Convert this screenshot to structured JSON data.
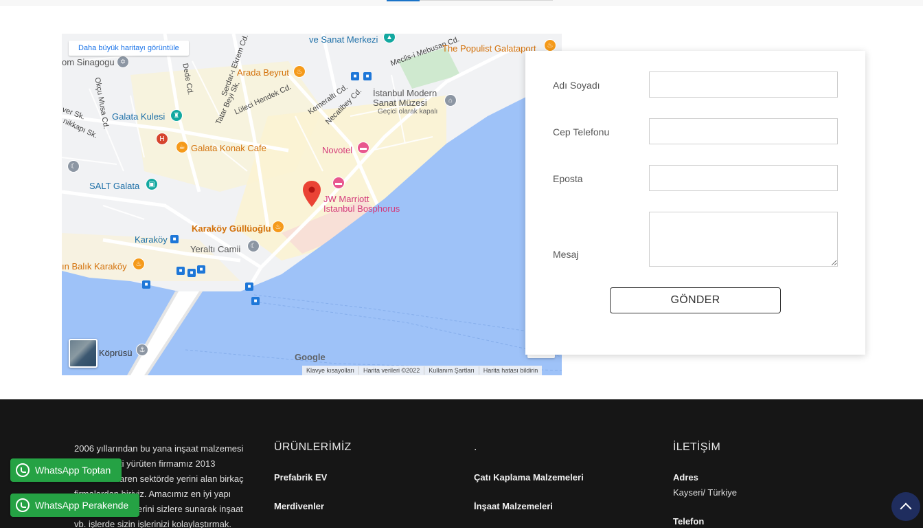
{
  "map": {
    "larger_map_link": "Daha büyük haritayı görüntüle",
    "labels": {
      "sanat_merkezi": "ve Sanat Merkezi",
      "populist": "The Populist Galataport",
      "sinagogu": "om Sinagogu",
      "arada_beyrut": "Arada Beyrut",
      "mebusan": "Meclis-i Mebusan Cd.",
      "kemeralti": "Kemeraltı Cd.",
      "necatibey": "Necatibey Cd.",
      "lulecihendek": "Lüleci Hendek Cd.",
      "serdar": "Serdar-ı Ekrem Cd.",
      "tatarbeyi": "Tatar Beyi Sk.",
      "dede": "Dede Cd.",
      "okcu": "Okçu Musa Cd.",
      "ver_sk": "ver Sk.",
      "kikapi": "nikkapı Sk.",
      "istanbul_modern_1": "İstanbul Modern",
      "istanbul_modern_2": "Sanat Müzesi",
      "istanbul_modern_3": "Geçici olarak kapalı",
      "galata_kulesi": "Galata Kulesi",
      "galata_konak": "Galata Konak Cafe",
      "novotel": "Novotel",
      "salt_galata": "SALT Galata",
      "jw_1": "JW Marriott",
      "jw_2": "Istanbul Bosphorus",
      "karakoy_gulluoglu": "Karaköy Güllüoğlu",
      "karakoy": "Karaköy",
      "yeralti": "Yeraltı Camii",
      "balik": "ın Balık Karaköy",
      "koprusu": "Köprüsü"
    },
    "google": "Google",
    "attribution": [
      "Klavye kısayolları",
      "Harita verileri ©2022",
      "Kullanım Şartları",
      "Harita hatası bildirin"
    ]
  },
  "form": {
    "name_label": "Adı Soyadı",
    "phone_label": "Cep Telefonu",
    "email_label": "Eposta",
    "message_label": "Mesaj",
    "submit_label": "GÖNDER"
  },
  "footer": {
    "about_lines": [
      "2006 yıllarından bu yana inşaat malzemesi",
      "ti  yürüten firmamız 2013",
      "aren sektörde yerini alan birkaç",
      "firmalardan biriyiz. Amacımız en iyi yapı",
      "erini sizlere sunarak inşaat",
      "vb. işlerde sizin işlerinizi kolaylaştırmak."
    ],
    "col2_head": "ÜRÜNLERİMİZ",
    "col2_links": [
      "Prefabrik EV",
      "Merdivenler"
    ],
    "col3_head": ".",
    "col3_links": [
      "Çatı Kaplama Malzemeleri",
      "İnşaat Malzemeleri"
    ],
    "col4_head": "İLETİŞİM",
    "address_label": "Adres",
    "address_value": "Kayseri/ Türkiye",
    "phone_label": "Telefon"
  },
  "whatsapp": {
    "toptan": "WhatsApp Toptan",
    "perakende": "WhatsApp Perakende"
  },
  "colors": {
    "water": "#9ec2f8",
    "footer_bg": "#161616",
    "whatsapp_green": "#25a244",
    "scroll_top_bg": "#1f2d5e"
  }
}
